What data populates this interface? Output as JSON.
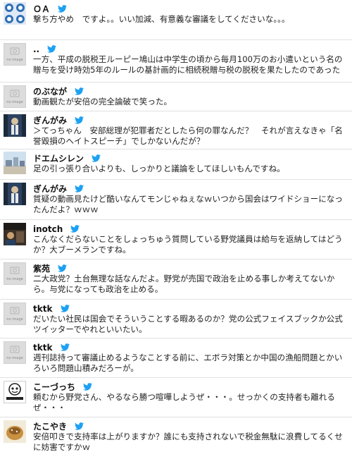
{
  "no_image_label": "no image",
  "tweets": [
    {
      "name": "ＯＡ",
      "text": "撃ち方やめ　ですよ。。いい加減、有意義な審議をしてくださいな。。。"
    },
    {
      "name": "..",
      "text": "一方、平成の脱税王ルーピー鳩山は中学生の頃から毎月100万のお小遣いという名の贈与を受け時効5年のルールの基計画的に相続税贈与税の脱税を果たしたのであった"
    },
    {
      "name": "のぶなが",
      "text": "動画観たが安倍の完全論破で笑った。"
    },
    {
      "name": "ぎんがみ",
      "text": "＞てっちゃん　安部総理が犯罪者だとしたら何の罪なんだ？　それが言えなきゃ「名誉毀損のヘイトスピーチ」でしかないんだが？"
    },
    {
      "name": "ドエムシレン",
      "text": "足の引っ張り合いよりも、しっかりと議論をしてほしいもんですね。"
    },
    {
      "name": "ぎんがみ",
      "text": "質疑の動画見たけど酷いなんてモンじゃねぇなｗいつから国会はワイドショーになったんだよ？ｗｗｗ"
    },
    {
      "name": "inotch",
      "text": "こんなくだらないことをしょっちゅう質問している野党議員は給与を返納してはどうか？大ブーメランですね。"
    },
    {
      "name": "紫苑",
      "text": "二大政党？土台無理な話なんだよ。野党が売国で政治を止める事しか考えてないから。与党になっても政治を止める。"
    },
    {
      "name": "tktk",
      "text": "だいたい社民は国会でそういうことする暇あるのか？党の公式フェイスブックか公式ツイッターでやれといいたい。"
    },
    {
      "name": "tktk",
      "text": "週刊誌持って審議止めるようなことする前に、エボラ対策とか中国の漁船問題とかいろいろ問題山積みだろーが。"
    },
    {
      "name": "こーづっち",
      "text": "頼むから野党さん、やるなら勝つ喧嘩しようぜ・・・。せっかくの支持者も離れるぜ・・・"
    },
    {
      "name": "たこやき",
      "text": "安倍叩きで支持率は上がりますか？誰にも支持されないで税金無駄に浪費してるくせに妨害ですかｗ"
    }
  ]
}
